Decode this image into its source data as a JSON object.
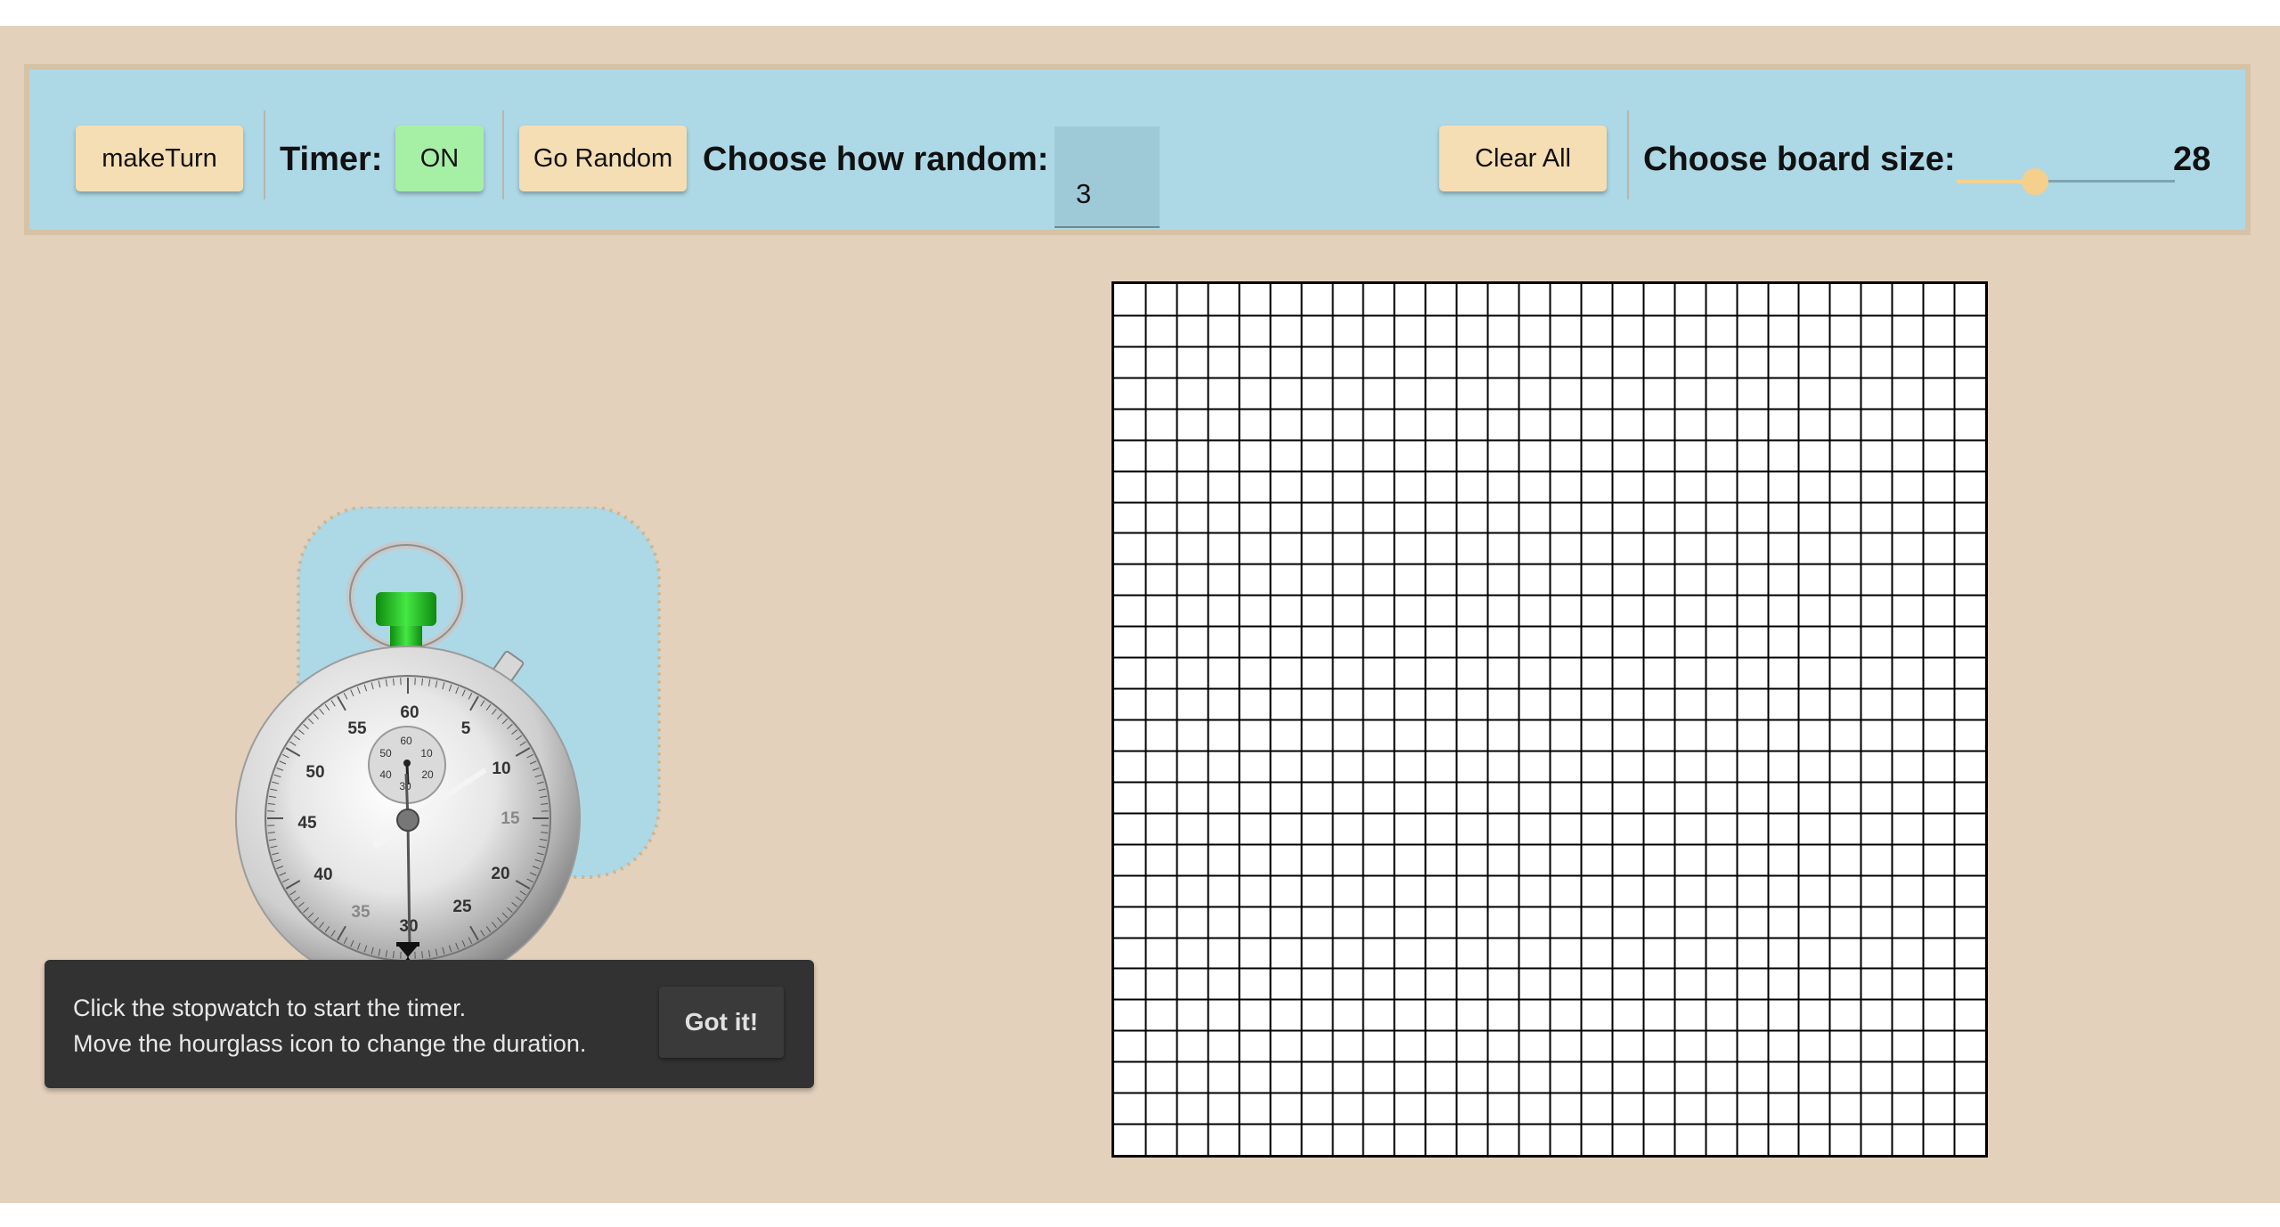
{
  "toolbar": {
    "make_turn_label": "makeTurn",
    "timer_label": "Timer:",
    "timer_state": "ON",
    "go_random_label": "Go Random",
    "how_random_label": "Choose how random:",
    "how_random_value": "3",
    "clear_all_label": "Clear All",
    "board_size_label": "Choose board size:",
    "board_size_value": "28",
    "board_size_slider_fraction": 0.36
  },
  "stopwatch": {
    "icon": "stopwatch-icon",
    "dial_numbers": [
      "60",
      "5",
      "10",
      "15",
      "20",
      "25",
      "30",
      "35",
      "40",
      "45",
      "50",
      "55"
    ],
    "subdial_numbers": [
      "60",
      "10",
      "20",
      "30",
      "40",
      "50"
    ]
  },
  "toast": {
    "line1": "Click the stopwatch to start the timer.",
    "line2": "Move the hourglass icon to change the duration.",
    "dismiss_label": "Got it!"
  },
  "board": {
    "size": 28
  },
  "colors": {
    "background": "#e3d1bc",
    "toolbar": "#add8e6",
    "button": "#f5deb3",
    "timer_on": "#a6f0a6",
    "toast": "#323232",
    "knob": "#22cc22"
  }
}
